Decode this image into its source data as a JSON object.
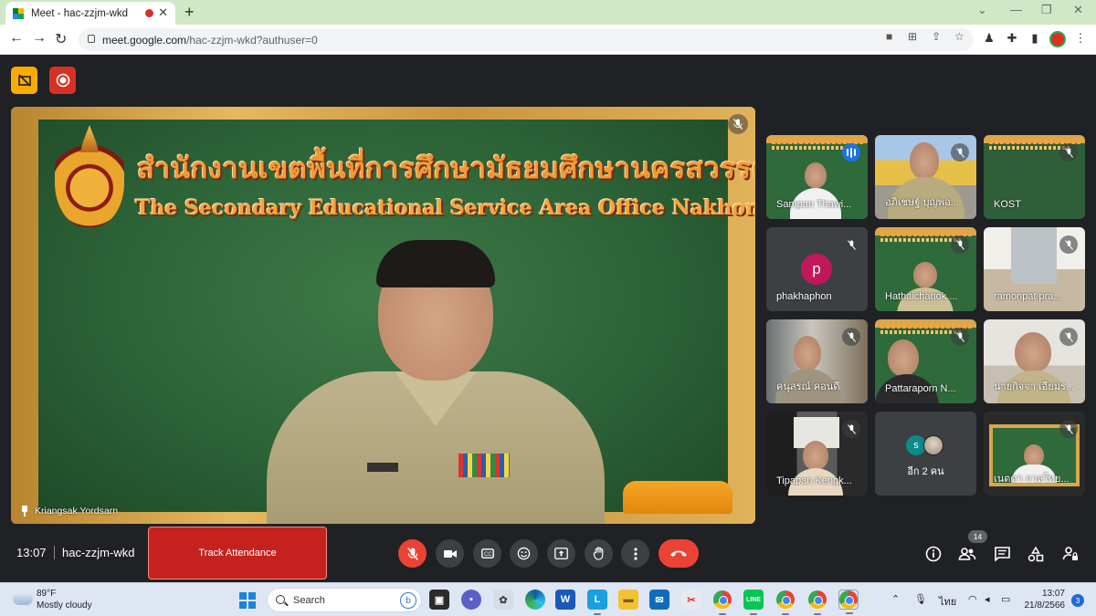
{
  "browser": {
    "tab_title": "Meet - hac-zzjm-wkd",
    "url_host": "meet.google.com",
    "url_path": "/hac-zzjm-wkd?authuser=0"
  },
  "meet": {
    "main_tile": {
      "heading_th": "สำนักงานเขตพื้นที่การศึกษามัธยมศึกษานครสวรรค์",
      "heading_en": "The Secondary Educational Service Area Office Nakhon Sawan",
      "participant": "Kriangsak Yordsarn"
    },
    "participants": [
      {
        "name": "Sampan Thawi...",
        "speaking": true
      },
      {
        "name": "อภิเชษฐ์ บุญพอ..."
      },
      {
        "name": "KOST"
      },
      {
        "name": "phakhaphon",
        "avatar_letter": "p"
      },
      {
        "name": "Hathaichanok ..."
      },
      {
        "name": "ramonpat pra..."
      },
      {
        "name": "คนุสรณ์ คอนดี"
      },
      {
        "name": "Pattaraporn N..."
      },
      {
        "name": "นายกิจจา เอียมร..."
      },
      {
        "name": "Tipapan Kengk..."
      },
      {
        "name": "อีก 2 คน",
        "avatar_letter": "s"
      },
      {
        "name": "เนตดา กวลใหย..."
      }
    ],
    "bar": {
      "time": "13:07",
      "meeting_code": "hac-zzjm-wkd",
      "attendance_button": "Track Attendance",
      "people_count": "14"
    }
  },
  "taskbar": {
    "temperature": "89°F",
    "condition": "Mostly cloudy",
    "search_placeholder": "Search",
    "language": "ไทย",
    "clock_time": "13:07",
    "clock_date": "21/8/2566",
    "notification_count": "3"
  },
  "colors": {
    "meet_bg": "#202124",
    "tile_bg": "#3c4043",
    "end_call": "#ea4335",
    "active_outline": "#8ab4f8",
    "attendance_button": "#c5221f"
  }
}
